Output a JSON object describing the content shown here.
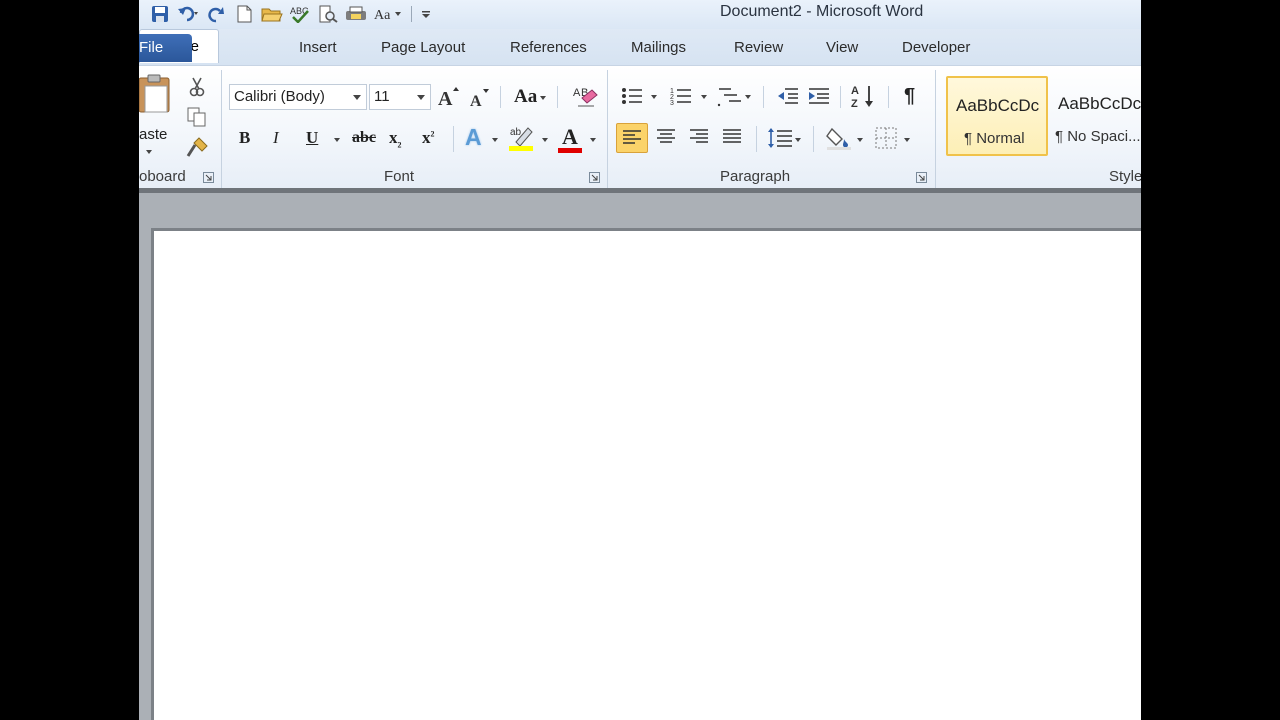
{
  "window": {
    "title": "Document2 - Microsoft Word"
  },
  "qat": {
    "icons": [
      "save-icon",
      "undo-icon",
      "redo-icon",
      "new-document-icon",
      "open-icon",
      "spelling-icon",
      "print-preview-icon",
      "quick-print-icon",
      "font-icon",
      "customize-icon"
    ]
  },
  "tabs": {
    "file": "File",
    "home": "Home",
    "insert": "Insert",
    "page_layout": "Page Layout",
    "references": "References",
    "mailings": "Mailings",
    "review": "Review",
    "view": "View",
    "developer": "Developer"
  },
  "clipboard": {
    "paste_label": "aste",
    "group_label": "oboard"
  },
  "font": {
    "font_name": "Calibri (Body)",
    "font_size": "11",
    "change_case": "Aa",
    "bold": "B",
    "italic": "I",
    "underline": "U",
    "strikethrough": "abc",
    "subscript": "x",
    "subscript_mark": "2",
    "superscript": "x",
    "superscript_mark": "2",
    "text_effects": "A",
    "font_color": "A",
    "group_label": "Font"
  },
  "paragraph": {
    "show_hide": "¶",
    "group_label": "Paragraph"
  },
  "styles": {
    "items": [
      {
        "sample": "AaBbCcDc",
        "name": "¶ Normal"
      },
      {
        "sample": "AaBbCcDc",
        "name": "¶ No Spaci..."
      }
    ],
    "group_label": "Style"
  },
  "colors": {
    "file_tab": "#2b579a",
    "font_color_bar": "#e00000",
    "highlight_bar": "#ffff00",
    "selected_style_border": "#f0c24a",
    "align_active": "#fbd36a"
  }
}
